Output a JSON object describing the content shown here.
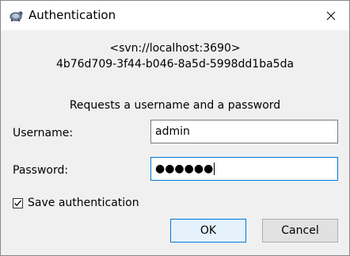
{
  "window": {
    "title": "Authentication"
  },
  "info": {
    "realm": "<svn://localhost:3690>",
    "uuid": "4b76d709-3f44-b046-8a5d-5998dd1ba5da",
    "prompt": "Requests a username and a password"
  },
  "form": {
    "username_label": "Username:",
    "username_value": "admin",
    "password_label": "Password:",
    "password_masked": "●●●●●●",
    "save_auth_label": "Save authentication",
    "save_auth_checked": true
  },
  "buttons": {
    "ok_label": "OK",
    "cancel_label": "Cancel"
  },
  "colors": {
    "focus_border": "#0078d7",
    "ok_bg": "#e5f1fb",
    "cancel_bg": "#e1e1e1"
  }
}
